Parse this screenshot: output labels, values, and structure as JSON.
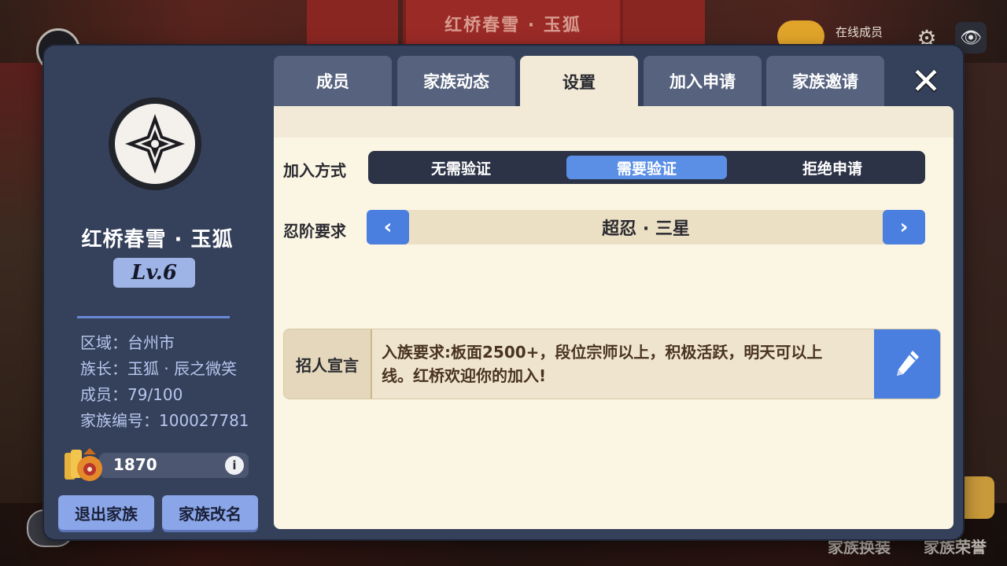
{
  "background": {
    "banner_title": "红桥春雪 · 玉狐",
    "online_label": "在线成员",
    "bottom_links": [
      "家族换装",
      "家族荣誉"
    ]
  },
  "sidebar": {
    "clan_name": "红桥春雪 · 玉狐",
    "level": "Lv.6",
    "info": [
      "区域：台州市",
      "族长：玉狐 · 辰之微笑",
      "成员：79/100",
      "家族编号：100027781"
    ],
    "coins": "1870",
    "info_icon": "i",
    "buttons": {
      "quit": "退出家族",
      "rename": "家族改名"
    }
  },
  "tabs": [
    "成员",
    "家族动态",
    "设置",
    "加入申请",
    "家族邀请"
  ],
  "active_tab": "设置",
  "settings": {
    "join_method_label": "加入方式",
    "join_options": [
      "无需验证",
      "需要验证",
      "拒绝申请"
    ],
    "join_selected": "需要验证",
    "rank_label": "忍阶要求",
    "rank_value": "超忍 · 三星",
    "declaration_label": "招人宣言",
    "declaration_text": "入族要求:板面2500+，段位宗师以上，积极活跃，明天可以上线。红桥欢迎你的加入!"
  },
  "icons": {
    "close": "close-icon",
    "edit": "pencil-icon",
    "prev": "chevron-left-icon",
    "next": "chevron-right-icon",
    "settings": "gear-icon",
    "view": "eye-icon",
    "info": "info-icon",
    "coins": "coin-bag-icon",
    "emblem": "shuriken-emblem-icon"
  },
  "colors": {
    "dialog_bg": "#35405a",
    "panel_bg": "#fbf6e4",
    "accent_blue": "#4a7fe0",
    "selected_option": "#5b8fe6",
    "level_badge": "#9fb4e6"
  }
}
